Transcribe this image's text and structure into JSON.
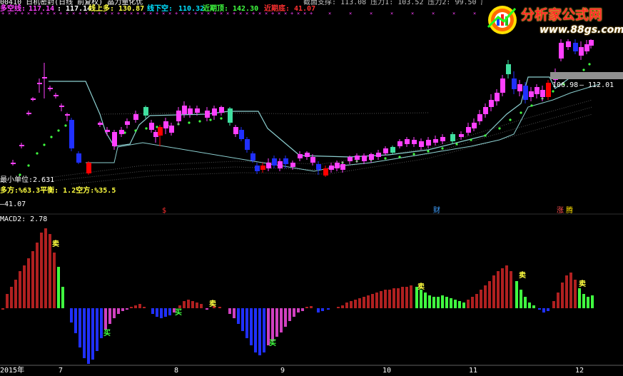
{
  "header": {
    "title_text": "00410 日机密封(日线 前复权) 晶力量化优",
    "top_right_text": "截面支撑: 113.08 压力1: 103.52 压力2: 99.50 压力3:",
    "line2": {
      "duo_label": "多空线:",
      "duo_value": "117.14",
      "v2": ": 117.14",
      "xianshang_label": "线上多:",
      "xianshang_value": "130.87",
      "xianxia_label": "线下空:",
      "xianxia_value": "110.32",
      "jinqiding_label": "近期顶:",
      "jinqiding_value": "142.30",
      "jinqidi_label": "近期底:",
      "jinqidi_value": "41.07"
    }
  },
  "logo": {
    "title": "分析家公式网",
    "url": "www.88gs.com"
  },
  "main_panel": {
    "min_unit": "最小单位:2.631",
    "duokong_ratio": "多方:%63.3平衡: 1.2空方:%35.5",
    "low_label": "41.07",
    "price_right_left": "106.98",
    "price_right_sep": "—",
    "price_right_right": "112.01",
    "event_markers": [
      {
        "label": "$",
        "color": "#ff3030"
      },
      {
        "label": "财",
        "color": "#40a0ff"
      },
      {
        "label": "涨",
        "color": "#ff5050"
      },
      {
        "label": "腾",
        "color": "#ffe000"
      }
    ]
  },
  "macd_panel": {
    "name_label": "MACD2:",
    "name_value": "2.78",
    "signals": [
      "卖",
      "买",
      "卖",
      "买",
      "买",
      "卖",
      "卖",
      "卖"
    ]
  },
  "x_axis": {
    "labels": [
      "2015年",
      "7",
      "8",
      "9",
      "10",
      "11",
      "12"
    ]
  },
  "colors": {
    "up": "#ff40ff",
    "down": "#2030ff",
    "bull_red": "#ff0000",
    "bull_cyan": "#40e0a0",
    "band": "#8ccfd0",
    "dots": "#40ff40",
    "macd_pos": "#b02020",
    "macd_neg": "#2030ff",
    "macd_green": "#40ff40",
    "macd_pink": "#d040c0",
    "yellow": "#ffff40",
    "cyan": "#00e0ff"
  }
}
